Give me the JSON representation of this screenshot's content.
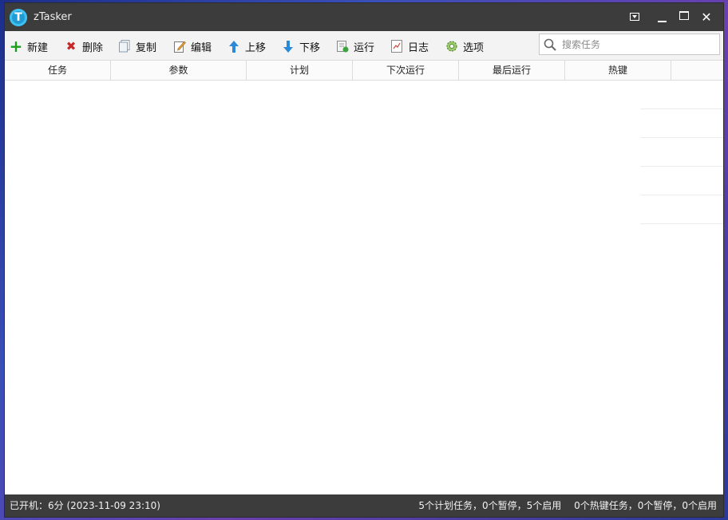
{
  "window": {
    "title": "zTasker",
    "app_icon_letter": "T"
  },
  "toolbar": {
    "items": [
      {
        "label": "新建",
        "icon": "plus-icon"
      },
      {
        "label": "删除",
        "icon": "delete-x-icon"
      },
      {
        "label": "复制",
        "icon": "copy-icon"
      },
      {
        "label": "编辑",
        "icon": "edit-icon"
      },
      {
        "label": "上移",
        "icon": "arrow-up-icon"
      },
      {
        "label": "下移",
        "icon": "arrow-down-icon"
      },
      {
        "label": "运行",
        "icon": "run-icon"
      },
      {
        "label": "日志",
        "icon": "log-icon"
      },
      {
        "label": "选项",
        "icon": "gear-icon"
      }
    ],
    "search_placeholder": "搜索任务",
    "search_value": ""
  },
  "table": {
    "columns": [
      "任务",
      "参数",
      "计划",
      "下次运行",
      "最后运行",
      "热键"
    ],
    "rows": []
  },
  "statusbar": {
    "uptime": "已开机：6分 (2023-11-09 23:10)",
    "scheduled_summary": "5个计划任务，0个暂停，5个启用",
    "hotkey_summary": "0个热键任务，0个暂停，0个启用"
  },
  "colors": {
    "titlebar": "#3c3c3c",
    "toolbar": "#f3f3f3",
    "add_green": "#1a9e1a",
    "delete_red": "#c62828",
    "arrow_blue": "#1e88e5"
  }
}
